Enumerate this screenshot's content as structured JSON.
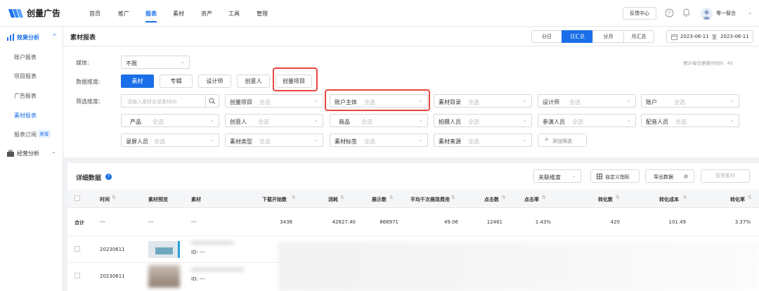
{
  "brand": {
    "name": "创量广告",
    "accent": "#1a6fe8",
    "highlight": "#e8463c"
  },
  "topnav": [
    "首页",
    "推广",
    "报表",
    "素材",
    "资产",
    "工具",
    "管理"
  ],
  "top_right": {
    "feedback": "反馈中心",
    "user": "零一智合"
  },
  "sidebar": {
    "group1": "效果分析",
    "items": [
      "账户报表",
      "项目报表",
      "广告报表",
      "素材报表",
      "报表订阅"
    ],
    "new_badge": "新增",
    "group2": "经营分析"
  },
  "page_title": "素材报表",
  "range_tabs": [
    "分日",
    "日汇总",
    "分月",
    "月汇总"
  ],
  "date_range": {
    "start": "2023-06-11",
    "sep": "至",
    "end": "2023-06-11"
  },
  "media": {
    "label": "媒体:",
    "value": "不限"
  },
  "refresh_note": "预计每日更新时间9：45",
  "dimension": {
    "label": "数据维度:",
    "options": [
      "素材",
      "专辑",
      "设计师",
      "创意人",
      "创量项目"
    ]
  },
  "filter": {
    "label": "筛选维度:",
    "search_placeholder": "请输入素材名或素材ID",
    "all": "全选",
    "row1": [
      "创量项目",
      "账户主体",
      "素材目录",
      "设计师",
      "账户"
    ],
    "row2": [
      "产品",
      "创意人",
      "商品",
      "拍摄人员",
      "参演人员",
      "配音人员"
    ],
    "row3": [
      "录屏人员",
      "素材类型",
      "素材标签",
      "素材来源"
    ],
    "add": "添加筛选"
  },
  "detail": {
    "title": "详细数据",
    "assoc": "关联维度",
    "custom": "自定义指标",
    "export": "导出数据",
    "manage": "管理素材"
  },
  "table": {
    "headers": [
      "时间",
      "素材预览",
      "素材",
      "下载开始数",
      "消耗",
      "展示数",
      "平均千次展现费用",
      "点击数",
      "点击率",
      "转化数",
      "转化成本",
      "转化率"
    ],
    "total": {
      "label": "合计",
      "time": "---",
      "preview": "---",
      "material": "---",
      "values": [
        "3438",
        "42627.40",
        "868971",
        "49.06",
        "12461",
        "1.43%",
        "420",
        "101.49",
        "3.37%"
      ]
    },
    "rows": [
      {
        "date": "20230611",
        "id": "ID: ---"
      },
      {
        "date": "20230611",
        "id": "ID: ---"
      }
    ]
  }
}
